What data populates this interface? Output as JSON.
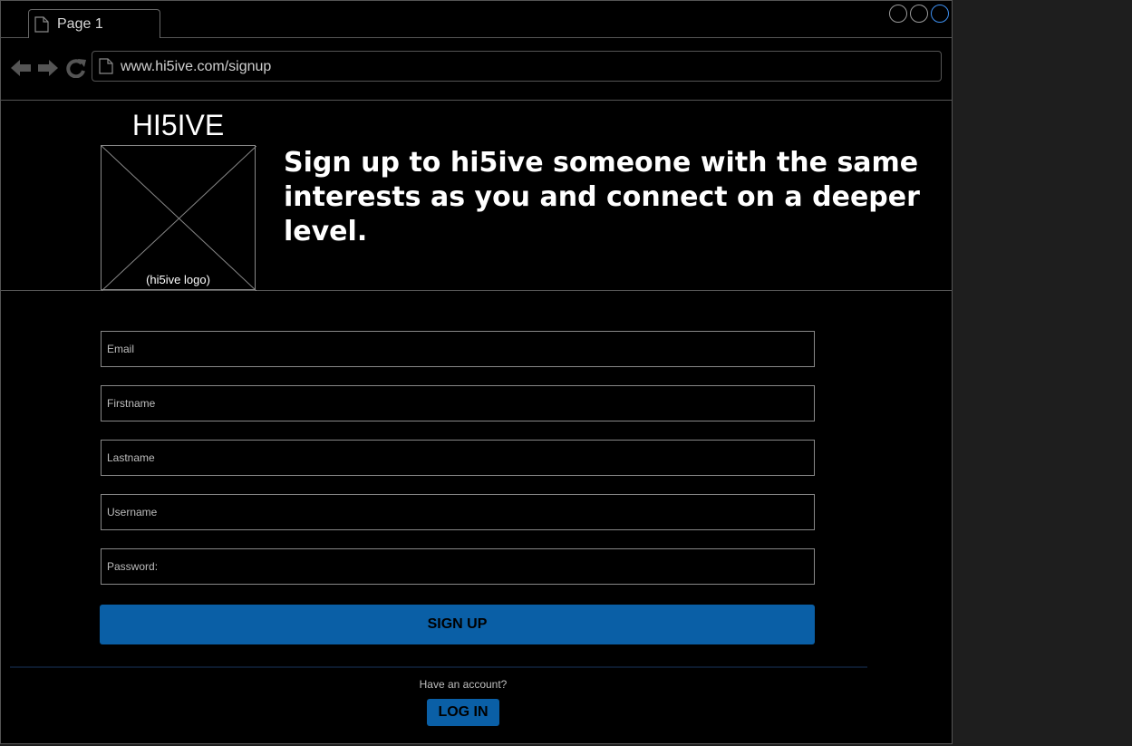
{
  "tab": {
    "label": "Page 1",
    "icon": "page-icon"
  },
  "window_controls": [
    {
      "name": "window-control-1",
      "active": false
    },
    {
      "name": "window-control-2",
      "active": false
    },
    {
      "name": "window-control-3",
      "active": true
    }
  ],
  "nav": {
    "back_icon": "back-arrow-icon",
    "forward_icon": "forward-arrow-icon",
    "reload_icon": "reload-icon",
    "url": "www.hi5ive.com/signup"
  },
  "header": {
    "brand": "HI5IVE",
    "logo_caption": "(hi5ive logo)",
    "tagline": "Sign up to hi5ive someone with the same interests as you and connect on a deeper level."
  },
  "form": {
    "fields": [
      {
        "label": "Email"
      },
      {
        "label": "Firstname"
      },
      {
        "label": "Lastname"
      },
      {
        "label": "Username"
      },
      {
        "label": "Password:"
      }
    ],
    "signup_label": "SIGN UP"
  },
  "footer": {
    "have_account": "Have an account?",
    "login_label": "LOG IN"
  },
  "colors": {
    "button_blue": "#0a5fa6",
    "active_control": "#3d8ff0",
    "background": "#000000"
  }
}
